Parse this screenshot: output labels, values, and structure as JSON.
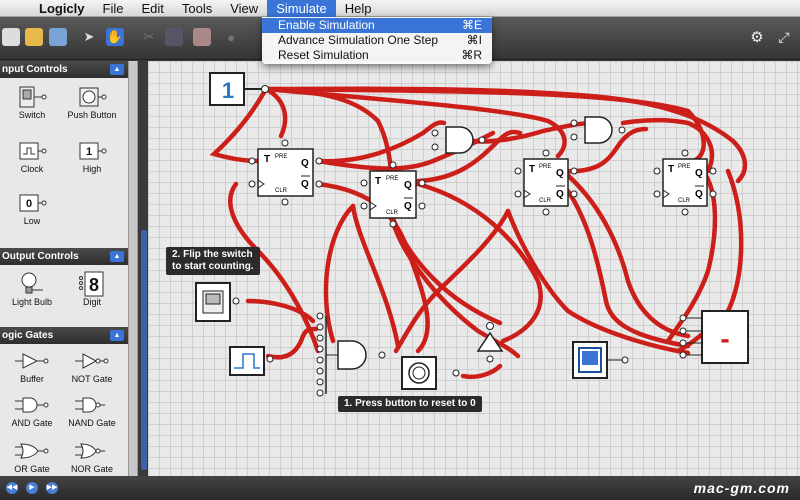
{
  "menubar": {
    "app": "Logicly",
    "items": [
      "File",
      "Edit",
      "Tools",
      "View",
      "Simulate",
      "Help"
    ]
  },
  "simulate_menu": {
    "items": [
      {
        "label": "Enable Simulation",
        "shortcut": "⌘E"
      },
      {
        "label": "Advance Simulation One Step",
        "shortcut": "⌘I"
      },
      {
        "label": "Reset Simulation",
        "shortcut": "⌘R"
      }
    ]
  },
  "sidebar": {
    "input_controls": {
      "title": "nput Controls",
      "items": [
        "Switch",
        "Push Button",
        "Clock",
        "High",
        "Low"
      ]
    },
    "output_controls": {
      "title": "Output Controls",
      "items": [
        "Light Bulb",
        "Digit"
      ]
    },
    "logic_gates": {
      "title": "ogic Gates",
      "items": [
        "Buffer",
        "NOT Gate",
        "AND Gate",
        "NAND Gate",
        "OR Gate",
        "NOR Gate"
      ]
    }
  },
  "canvas": {
    "high_value": "1",
    "annotation_flip": "2. Flip the switch\nto start counting.",
    "annotation_press": "1. Press button to reset to 0",
    "flipflop_labels": {
      "t": "T",
      "q": "Q",
      "pre": "PRE",
      "clr": "CLR",
      "qbar": "Q"
    },
    "digit_display": "-"
  },
  "watermark": "mac-gm.com",
  "colors": {
    "wire": "#cc1f1a",
    "accent": "#3a74d6"
  }
}
